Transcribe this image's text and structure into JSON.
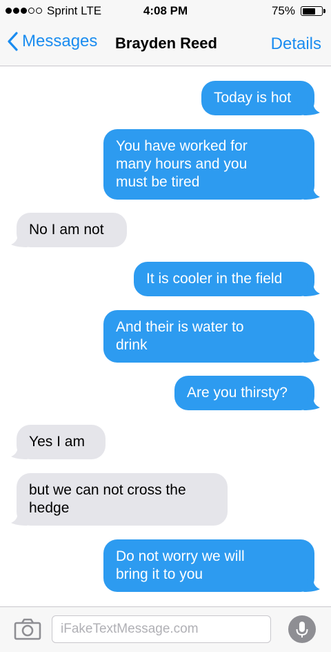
{
  "status_bar": {
    "carrier": "Sprint  LTE",
    "time": "4:08 PM",
    "battery_percent": "75%",
    "battery_level": 0.75,
    "signal_bars": 3,
    "signal_total": 5
  },
  "nav": {
    "back_label": "Messages",
    "contact_name": "Brayden Reed",
    "details_label": "Details"
  },
  "messages": [
    {
      "direction": "sent",
      "text": "Today is hot"
    },
    {
      "direction": "sent",
      "text": "You have worked for\nmany hours and you\nmust be tired"
    },
    {
      "direction": "received",
      "text": "No I am not"
    },
    {
      "direction": "sent",
      "text": "It is cooler in the field"
    },
    {
      "direction": "sent",
      "text": "And their is water to\ndrink"
    },
    {
      "direction": "sent",
      "text": "Are you thirsty?"
    },
    {
      "direction": "received",
      "text": "Yes I am"
    },
    {
      "direction": "received",
      "text": "but we can not cross the\nhedge"
    },
    {
      "direction": "sent",
      "text": "Do not worry we will\nbring it to you"
    }
  ],
  "input_bar": {
    "placeholder": "iFakeTextMessage.com",
    "camera_icon": "camera-icon",
    "mic_icon": "microphone-icon"
  },
  "colors": {
    "accent": "#1a8cf0",
    "sent_bubble": "#2d9bf0",
    "received_bubble": "#e5e5ea",
    "bar_background": "#f7f7f7"
  }
}
